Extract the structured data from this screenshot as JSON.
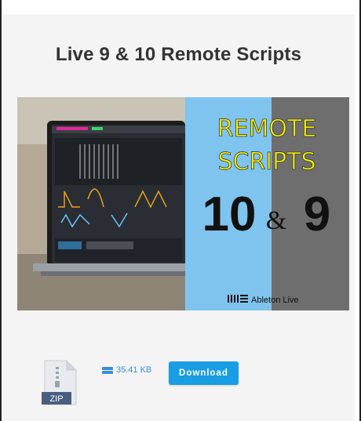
{
  "page": {
    "title": "Live 9 & 10 Remote Scripts"
  },
  "banner": {
    "line1": "REMOTE",
    "line2": "SCRIPTS",
    "num_left": "10",
    "amp": "&",
    "num_right": "9",
    "brand_text": "Ableton Live",
    "colors": {
      "blue_panel": "#7fc4ef",
      "gray_panel": "#6e6e6e",
      "yellow_text": "#f6f000"
    }
  },
  "file": {
    "type_label": "ZIP",
    "size": "35.41 KB",
    "icon": "zip-file-icon",
    "size_icon": "hard-drive-icon"
  },
  "actions": {
    "download_label": "Download",
    "accent_color": "#1a9ee3"
  }
}
